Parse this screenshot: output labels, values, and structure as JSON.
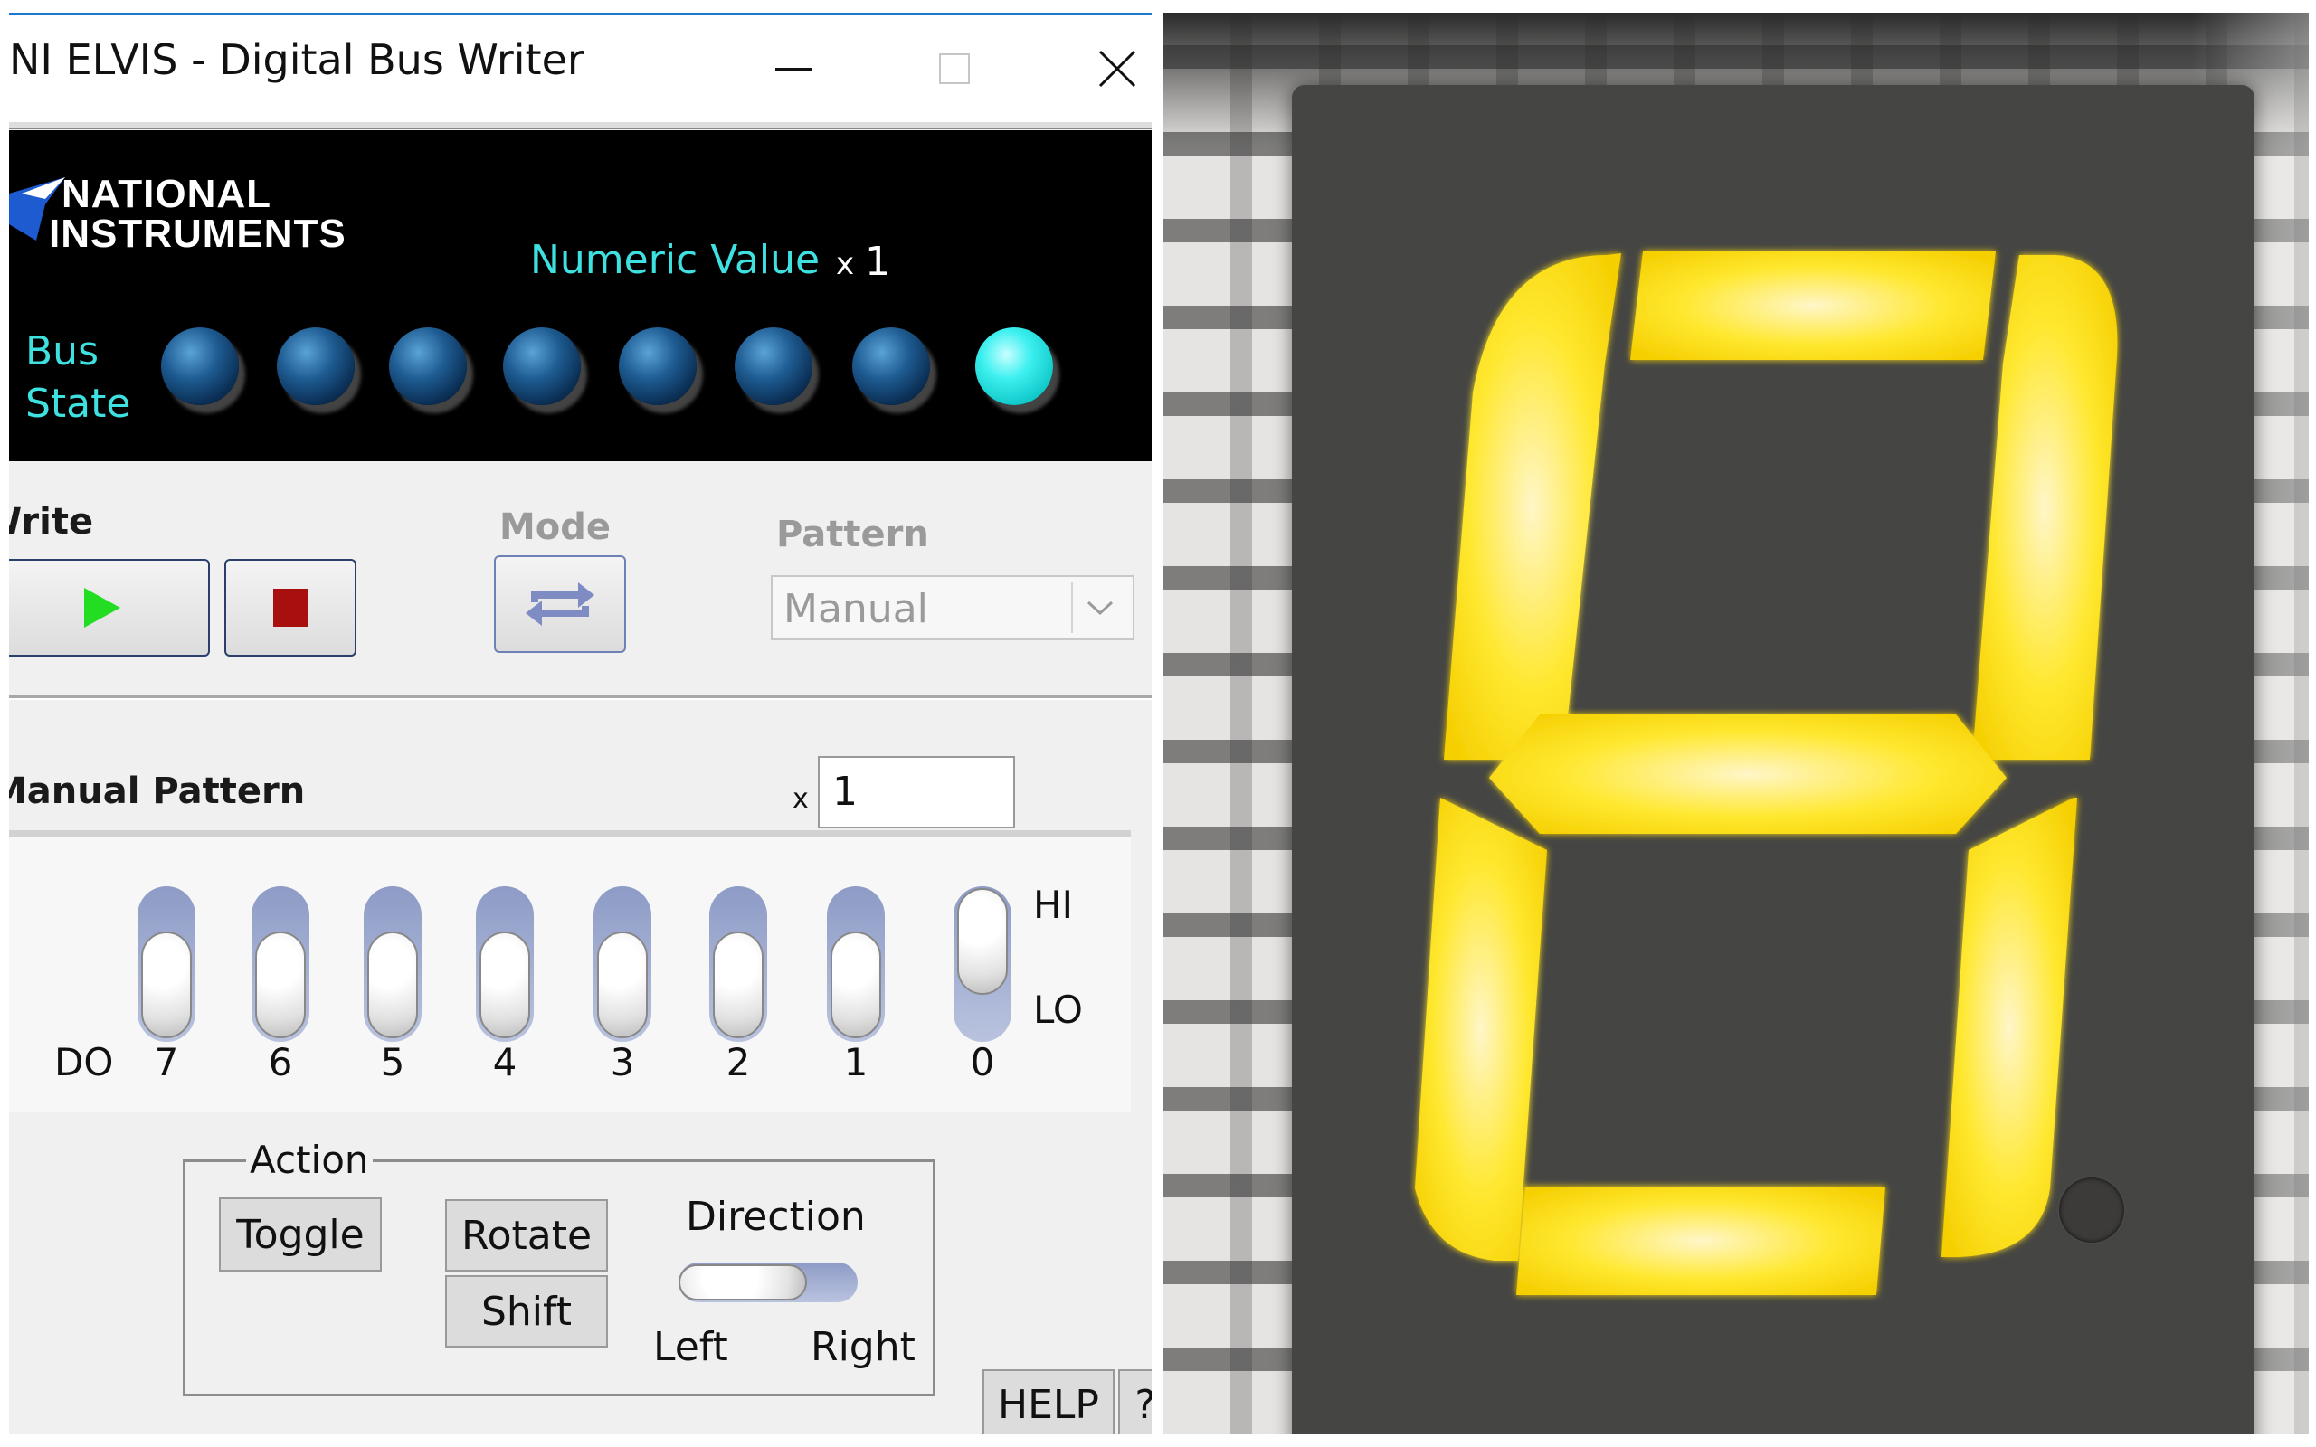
{
  "window": {
    "title": "NI ELVIS - Digital Bus Writer",
    "accent_color": "#1e78d2",
    "controls": [
      "minimize-icon",
      "maximize-icon",
      "close-icon"
    ]
  },
  "header": {
    "logo_line1": "NATIONAL",
    "logo_line2": "INSTRUMENTS",
    "numeric_label": "Numeric Value",
    "numeric_prefix": "x",
    "numeric_value": "1",
    "bus_label_line1": "Bus",
    "bus_label_line2": "State",
    "led_off_color": "#1e5c92",
    "led_on_color": "#3ef0f0",
    "bus_state": [
      false,
      false,
      false,
      false,
      false,
      false,
      false,
      true
    ]
  },
  "write": {
    "label": "Write",
    "play_icon": "play-icon",
    "stop_icon": "stop-icon"
  },
  "mode": {
    "label": "Mode",
    "icon": "loop-icon"
  },
  "pattern": {
    "label": "Pattern",
    "value": "Manual"
  },
  "manual_pattern": {
    "label": "Manual Pattern",
    "prefix": "x",
    "value": "1",
    "do_label": "DO",
    "hi_label": "HI",
    "lo_label": "LO",
    "bits": [
      {
        "label": "7",
        "state": "LO"
      },
      {
        "label": "6",
        "state": "LO"
      },
      {
        "label": "5",
        "state": "LO"
      },
      {
        "label": "4",
        "state": "LO"
      },
      {
        "label": "3",
        "state": "LO"
      },
      {
        "label": "2",
        "state": "LO"
      },
      {
        "label": "1",
        "state": "LO"
      },
      {
        "label": "0",
        "state": "HI"
      }
    ]
  },
  "action": {
    "title": "Action",
    "toggle": "Toggle",
    "rotate": "Rotate",
    "shift": "Shift",
    "direction": "Direction",
    "left": "Left",
    "right": "Right",
    "direction_value": "Left"
  },
  "footer": {
    "help": "HELP",
    "question": "?"
  },
  "photo": {
    "segment_color": "#ffe21a",
    "segment_hot_color": "#fff6c8",
    "lit_segments": [
      "a",
      "b",
      "c",
      "d",
      "e",
      "f",
      "g"
    ]
  }
}
